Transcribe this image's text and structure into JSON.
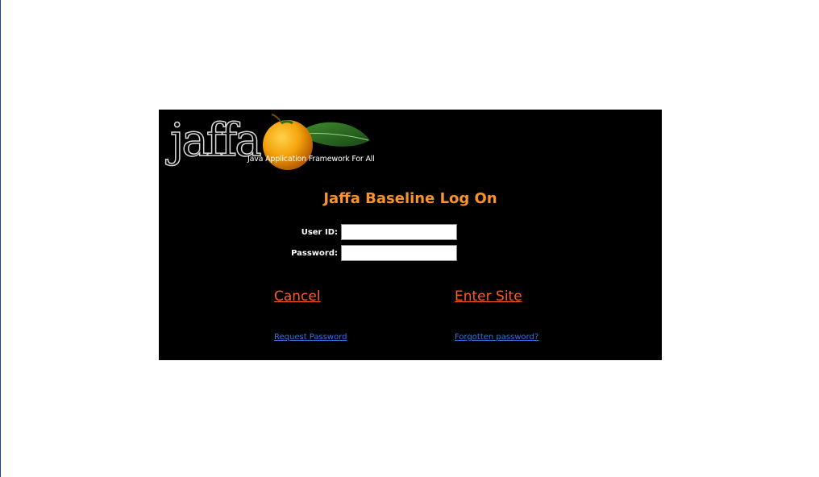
{
  "logo": {
    "word": "jaffa",
    "tagline": "Java Application Framework For All"
  },
  "login": {
    "title": "Jaffa Baseline Log On",
    "user_id_label": "User ID:",
    "user_id_value": "",
    "password_label": "Password:",
    "password_value": ""
  },
  "actions": {
    "cancel_label": "Cancel",
    "enter_label": "Enter Site",
    "request_password_label": "Request Password",
    "forgotten_password_label": "Forgotten password?"
  },
  "colors": {
    "panel_background": "#000000",
    "title": "#f7922d",
    "primary_links": "#ff5a1f",
    "secondary_links": "#3b6fe0"
  }
}
